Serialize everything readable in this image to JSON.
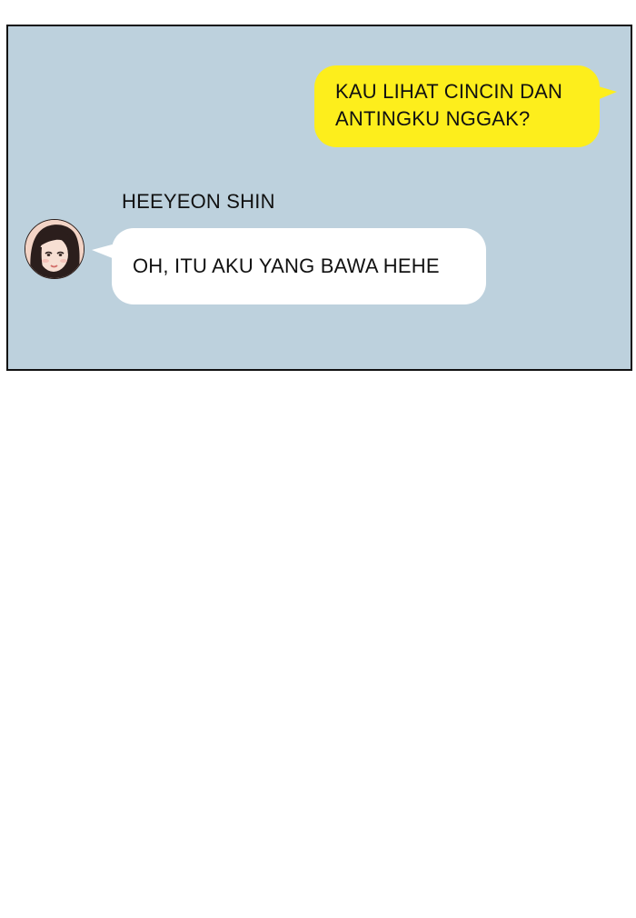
{
  "chat": {
    "outgoing_message": {
      "line1": "KAU LIHAT CINCIN DAN",
      "line2": "ANTINGKU NGGAK?"
    },
    "incoming_message": {
      "sender": "HEEYEON SHIN",
      "text": "OH, ITU AKU YANG BAWA HEHE"
    }
  },
  "colors": {
    "panel_background": "#bdd1dd",
    "outgoing_bubble": "#fdee1c",
    "incoming_bubble": "#ffffff",
    "panel_border": "#111111"
  },
  "icons": {
    "avatar": "avatar-woman-dark-hair"
  }
}
